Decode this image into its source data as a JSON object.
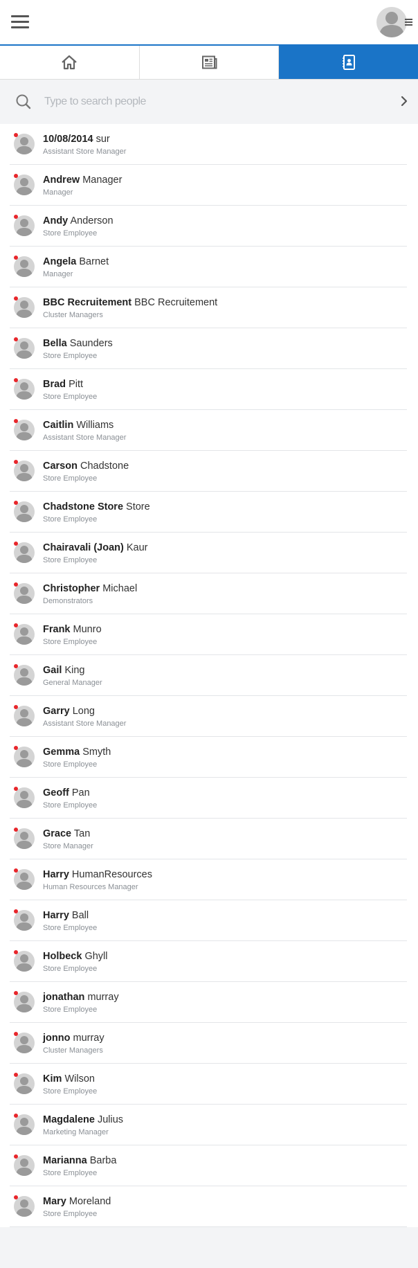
{
  "header": {
    "menu_icon": "hamburger-menu-icon",
    "profile_icon": "user-avatar-icon"
  },
  "tabs": [
    {
      "icon": "home-icon",
      "active": false
    },
    {
      "icon": "newspaper-icon",
      "active": false
    },
    {
      "icon": "contacts-book-icon",
      "active": true
    }
  ],
  "search": {
    "placeholder": "Type to search people",
    "value": ""
  },
  "colors": {
    "accent": "#1a74c7",
    "status_dot": "#e8262b"
  },
  "people": [
    {
      "first": "10/08/2014",
      "last": "sur",
      "role": "Assistant Store Manager"
    },
    {
      "first": "Andrew",
      "last": "Manager",
      "role": "Manager"
    },
    {
      "first": "Andy",
      "last": "Anderson",
      "role": "Store Employee"
    },
    {
      "first": "Angela",
      "last": "Barnet",
      "role": "Manager"
    },
    {
      "first": "BBC Recruitement",
      "last": "BBC Recruitement",
      "role": "Cluster Managers"
    },
    {
      "first": "Bella",
      "last": "Saunders",
      "role": "Store Employee"
    },
    {
      "first": "Brad",
      "last": "Pitt",
      "role": "Store Employee"
    },
    {
      "first": "Caitlin",
      "last": "Williams",
      "role": "Assistant Store Manager"
    },
    {
      "first": "Carson",
      "last": "Chadstone",
      "role": "Store Employee"
    },
    {
      "first": "Chadstone Store",
      "last": "Store",
      "role": "Store Employee"
    },
    {
      "first": "Chairavali (Joan)",
      "last": "Kaur",
      "role": "Store Employee"
    },
    {
      "first": "Christopher",
      "last": "Michael",
      "role": "Demonstrators"
    },
    {
      "first": "Frank",
      "last": "Munro",
      "role": "Store Employee"
    },
    {
      "first": "Gail",
      "last": "King",
      "role": "General Manager"
    },
    {
      "first": "Garry",
      "last": "Long",
      "role": "Assistant Store Manager"
    },
    {
      "first": "Gemma",
      "last": "Smyth",
      "role": "Store Employee"
    },
    {
      "first": "Geoff",
      "last": "Pan",
      "role": "Store Employee"
    },
    {
      "first": "Grace",
      "last": "Tan",
      "role": "Store Manager"
    },
    {
      "first": "Harry",
      "last": "HumanResources",
      "role": "Human Resources Manager"
    },
    {
      "first": "Harry",
      "last": "Ball",
      "role": "Store Employee"
    },
    {
      "first": "Holbeck",
      "last": "Ghyll",
      "role": "Store Employee"
    },
    {
      "first": "jonathan",
      "last": "murray",
      "role": "Store Employee"
    },
    {
      "first": "jonno",
      "last": "murray",
      "role": "Cluster Managers"
    },
    {
      "first": "Kim",
      "last": "Wilson",
      "role": "Store Employee"
    },
    {
      "first": "Magdalene",
      "last": "Julius",
      "role": "Marketing Manager"
    },
    {
      "first": "Marianna",
      "last": "Barba",
      "role": "Store Employee"
    },
    {
      "first": "Mary",
      "last": "Moreland",
      "role": "Store Employee"
    }
  ]
}
